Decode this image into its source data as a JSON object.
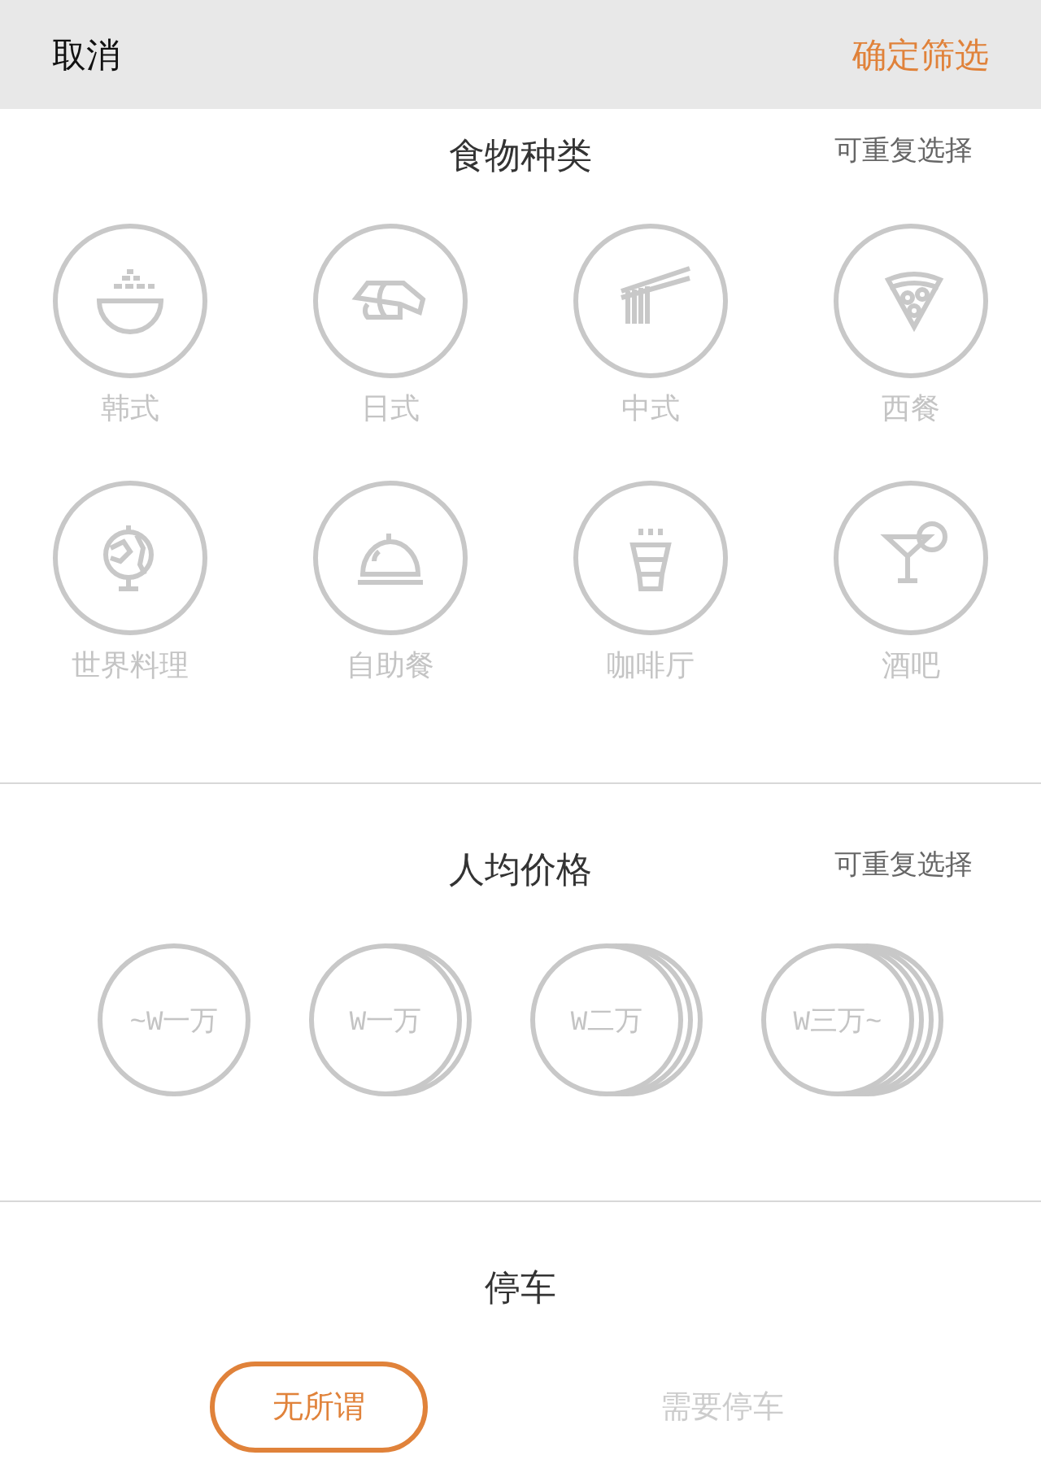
{
  "header": {
    "cancel": "取消",
    "confirm": "确定筛选"
  },
  "food_section": {
    "title": "食物种类",
    "hint": "可重复选择",
    "items": [
      {
        "label": "韩式",
        "kind": "rice",
        "selected": false
      },
      {
        "label": "日式",
        "kind": "sushi",
        "selected": false
      },
      {
        "label": "中式",
        "kind": "noodles",
        "selected": false
      },
      {
        "label": "西餐",
        "kind": "pizza",
        "selected": false
      },
      {
        "label": "世界料理",
        "kind": "globe",
        "selected": false
      },
      {
        "label": "自助餐",
        "kind": "cloche",
        "selected": false
      },
      {
        "label": "咖啡厅",
        "kind": "coffee",
        "selected": false
      },
      {
        "label": "酒吧",
        "kind": "cocktail",
        "selected": false
      }
    ]
  },
  "price_section": {
    "title": "人均价格",
    "hint": "可重复选择",
    "items": [
      {
        "label": "~W一万",
        "kind": "one",
        "selected": false
      },
      {
        "label": "W一万",
        "kind": "two",
        "selected": false
      },
      {
        "label": "W二万",
        "kind": "three",
        "selected": false
      },
      {
        "label": "W三万~",
        "kind": "four",
        "selected": false
      }
    ]
  },
  "parking_section": {
    "title": "停车",
    "options": [
      {
        "label": "无所谓",
        "selected": true
      },
      {
        "label": "需要停车",
        "selected": false
      }
    ]
  }
}
